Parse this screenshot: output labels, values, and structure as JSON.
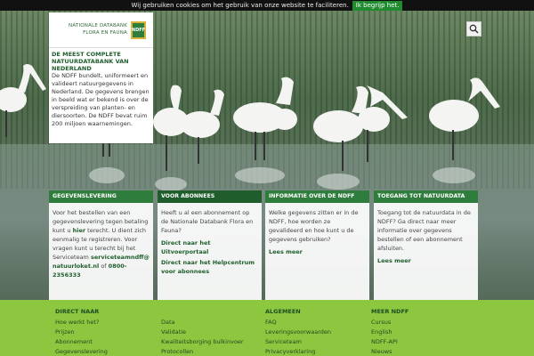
{
  "cookie": {
    "message": "Wij gebruiken cookies om het gebruik van onze website te faciliteren.",
    "accept_label": "Ik begrijp het."
  },
  "logo": {
    "line1": "NATIONALE DATABANK",
    "line2": "FLORA EN FAUNA",
    "mark": "NDFF"
  },
  "intro": {
    "heading": "DE MEEST COMPLETE NATUURDATABANK VAN NEDERLAND",
    "body": "De NDFF bundelt, uniformeert en valideert natuurgegevens in Nederland. De gegevens brengen in beeld wat er bekend is over de verspreiding van planten- en diersoorten. De NDFF bevat ruim 200 miljoen waarnemingen."
  },
  "search": {
    "icon": "search-icon"
  },
  "boxes": [
    {
      "title": "GEGEVENSLEVERING",
      "text_a": "Voor het bestellen van een gegevenslevering tegen betaling kunt u ",
      "text_b": "hier",
      "text_c": " terecht. U dient zich eenmalig te registreren. Voor vragen kunt u terecht bij het Serviceteam ",
      "email": "serviceteamndff@natuurloket.nl",
      "text_d": " of ",
      "phone": "0800-2356333"
    },
    {
      "title": "VOOR ABONNEES",
      "text": "Heeft u al een abonnement op de Nationale Databank Flora en Fauna?",
      "link1": "Direct naar het Uitvoerportaal",
      "link2": "Direct naar het Helpcentrum voor abonnees"
    },
    {
      "title": "INFORMATIE OVER DE NDFF",
      "text": "Welke gegevens zitten er in de NDFF, hoe worden ze gevalideerd en hoe kunt u de gegevens gebruiken?",
      "link": "Lees meer"
    },
    {
      "title": "TOEGANG TOT NATUURDATA",
      "text": "Toegang tot de natuurdata in de NDFF? Ga direct naar meer informatie over gegevens bestellen of een abonnement afsluiten.",
      "link": "Lees meer"
    }
  ],
  "footer": {
    "col1": {
      "title": "DIRECT NAAR",
      "items": [
        "Hoe werkt het?",
        "Prijzen",
        "Abonnement",
        "Gegevenslevering"
      ]
    },
    "col2": {
      "title": "",
      "items": [
        "Data",
        "Validatie",
        "Kwaliteitsborging bulkinvoer",
        "Protocollen"
      ]
    },
    "col3": {
      "title": "ALGEMEEN",
      "items": [
        "FAQ",
        "Leveringsvoorwaarden",
        "Serviceteam",
        "Privacyverklaring"
      ]
    },
    "col4": {
      "title": "MEER NDFF",
      "items": [
        "Cursus",
        "English",
        "NDFF-API",
        "Nieuws"
      ]
    }
  }
}
